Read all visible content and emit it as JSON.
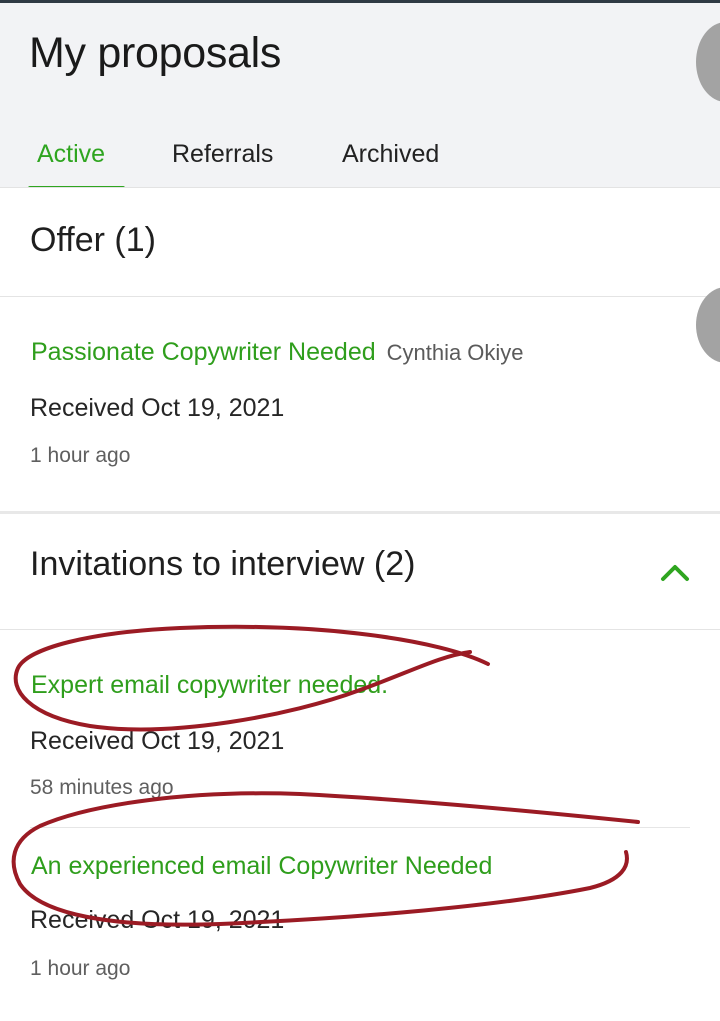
{
  "header": {
    "title": "My proposals"
  },
  "tabs": [
    {
      "label": "Active",
      "active": true
    },
    {
      "label": "Referrals",
      "active": false
    },
    {
      "label": "Archived",
      "active": false
    }
  ],
  "offer_section": {
    "title": "Offer (1)",
    "items": [
      {
        "job_title": "Passionate Copywriter Needed",
        "client": "Cynthia Okiye",
        "received": "Received Oct 19, 2021",
        "ago": "1 hour ago"
      }
    ]
  },
  "invitations_section": {
    "title": "Invitations to interview (2)",
    "expanded": true,
    "items": [
      {
        "job_title": "Expert email copywriter needed.",
        "received": "Received Oct 19, 2021",
        "ago": "58 minutes ago"
      },
      {
        "job_title": "An experienced email Copywriter Needed",
        "received": "Received Oct 19, 2021",
        "ago": "1 hour ago"
      }
    ]
  },
  "colors": {
    "accent_green": "#2fa520",
    "link_green": "#2f9e1c",
    "annotation_red": "#9b1b24",
    "header_bg": "#f2f3f5"
  }
}
